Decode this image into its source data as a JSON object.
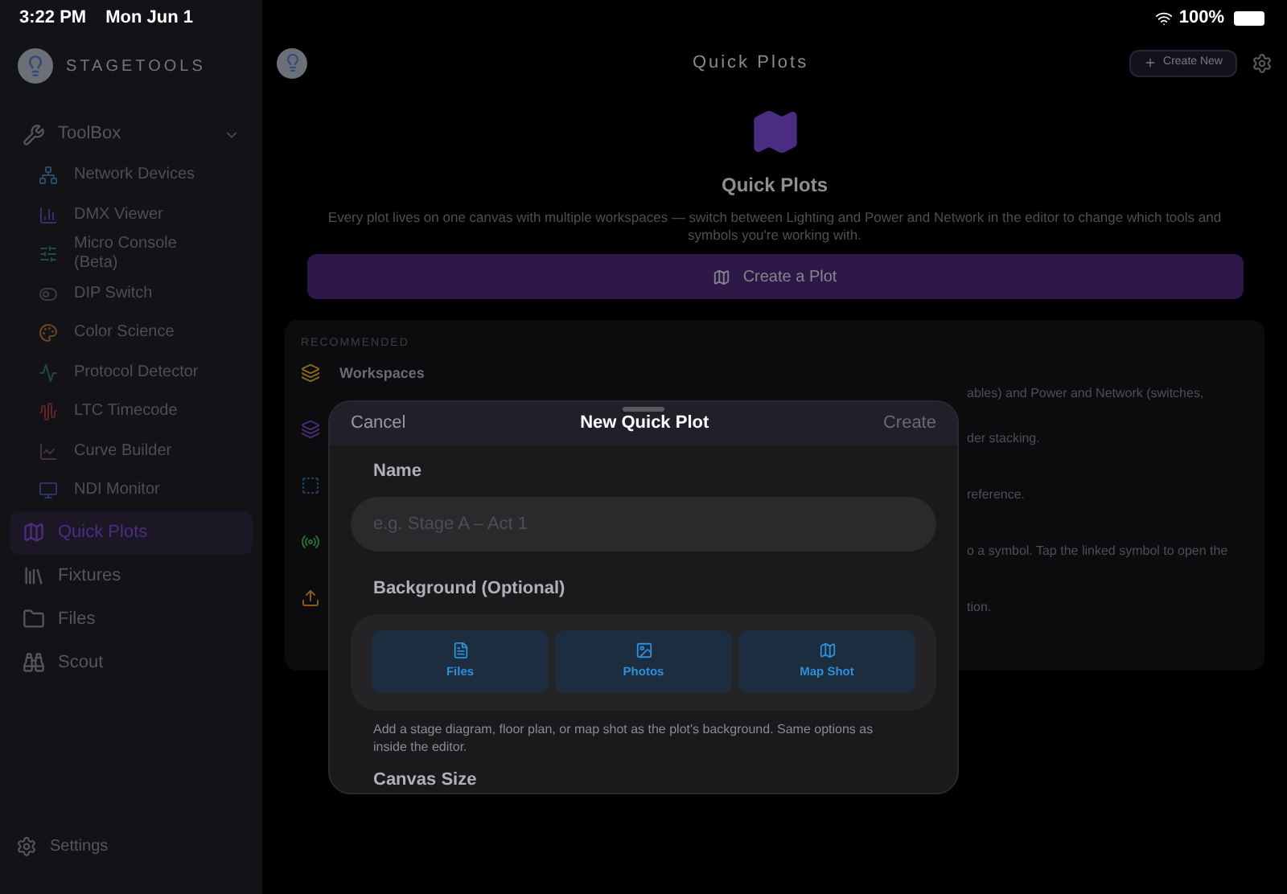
{
  "status_bar": {
    "time": "3:22 PM",
    "date": "Mon Jun 1",
    "battery": "100%"
  },
  "sidebar": {
    "brand": "STAGETOOLS",
    "items": [
      {
        "label": "ToolBox",
        "selected": false,
        "expanded": true,
        "children": [
          {
            "label": "Network Devices"
          },
          {
            "label": "DMX Viewer"
          },
          {
            "label": "Micro Console (Beta)"
          },
          {
            "label": "DIP Switch"
          },
          {
            "label": "Color Science"
          },
          {
            "label": "Protocol Detector"
          },
          {
            "label": "LTC Timecode"
          },
          {
            "label": "Curve Builder"
          },
          {
            "label": "NDI Monitor"
          }
        ]
      },
      {
        "label": "Quick Plots",
        "selected": true
      },
      {
        "label": "Fixtures",
        "selected": false
      },
      {
        "label": "Files",
        "selected": false
      },
      {
        "label": "Scout",
        "selected": false
      }
    ],
    "settings": "Settings"
  },
  "header": {
    "title": "Quick Plots",
    "create_button": "Create New"
  },
  "hero": {
    "title": "Quick Plots",
    "description": "Every plot lives on one canvas with multiple workspaces — switch between Lighting and Power and Network in the editor to change which tools and symbols you're working with.",
    "button": "Create a Plot"
  },
  "recommended": {
    "heading": "RECOMMENDED",
    "items": [
      {
        "title": "Workspaces",
        "text": "ables) and Power and Network (switches,"
      },
      {
        "text": "der stacking."
      },
      {
        "text": "reference."
      },
      {
        "text": "o a symbol. Tap the linked symbol to open the"
      },
      {
        "text": "tion."
      }
    ]
  },
  "modal": {
    "cancel": "Cancel",
    "title": "New Quick Plot",
    "create": "Create",
    "name_label": "Name",
    "name_placeholder": "e.g. Stage A – Act 1",
    "background_label": "Background (Optional)",
    "options": [
      "Files",
      "Photos",
      "Map Shot"
    ],
    "help": "Add a stage diagram, floor plan, or map shot as the plot's background. Same options as inside the editor.",
    "canvas_label": "Canvas Size"
  }
}
